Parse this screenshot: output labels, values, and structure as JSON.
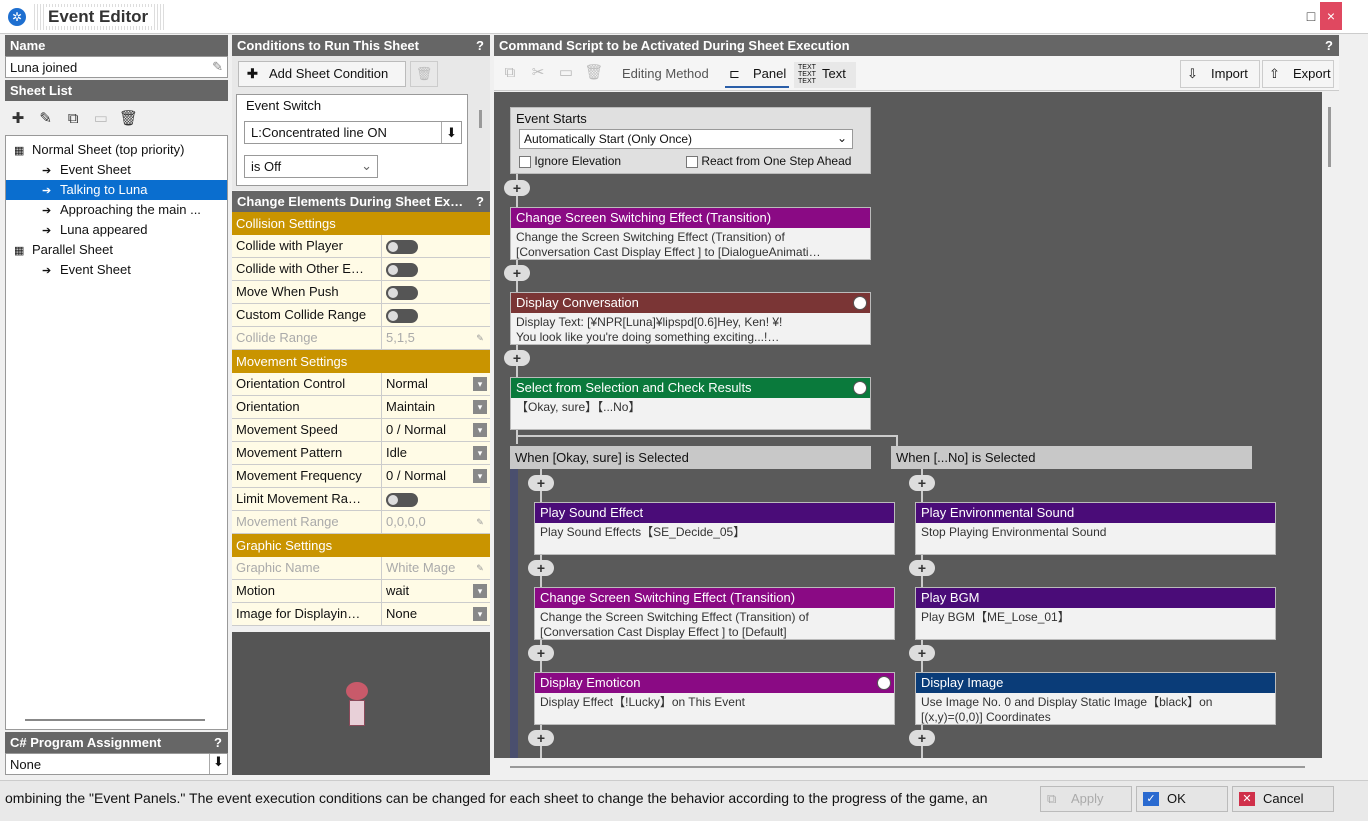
{
  "window": {
    "title": "Event Editor",
    "max_icon": "□",
    "close_icon": "×"
  },
  "left": {
    "name_header": "Name",
    "name_value": "Luna joined",
    "sheet_list_header": "Sheet List",
    "tree": [
      {
        "label": "Normal Sheet (top priority)",
        "indent": 0,
        "selected": false
      },
      {
        "label": "Event Sheet",
        "indent": 1,
        "selected": false
      },
      {
        "label": "Talking to Luna",
        "indent": 1,
        "selected": true
      },
      {
        "label": "Approaching the main ...",
        "indent": 1,
        "selected": false
      },
      {
        "label": "Luna appeared",
        "indent": 1,
        "selected": false
      },
      {
        "label": "Parallel Sheet",
        "indent": 0,
        "selected": false
      },
      {
        "label": "Event Sheet",
        "indent": 1,
        "selected": false
      }
    ],
    "csharp_header": "C# Program Assignment",
    "csharp_value": "None",
    "q": "?"
  },
  "conditions": {
    "header": "Conditions to Run This Sheet",
    "add_label": "Add Sheet Condition",
    "event_switch_label": "Event Switch",
    "switch_value": "L:Concentrated line ON",
    "state_value": "is Off"
  },
  "change": {
    "header": "Change Elements During Sheet Ex…",
    "collision": "Collision Settings",
    "rows1": [
      {
        "k": "Collide with Player",
        "type": "toggle"
      },
      {
        "k": "Collide with Other E…",
        "type": "toggle"
      },
      {
        "k": "Move When Push",
        "type": "toggle"
      },
      {
        "k": "Custom Collide Range",
        "type": "toggle"
      },
      {
        "k": "Collide Range",
        "v": "5,1,5",
        "type": "dis"
      }
    ],
    "movement": "Movement Settings",
    "rows2": [
      {
        "k": "Orientation Control",
        "v": "Normal",
        "type": "dd"
      },
      {
        "k": "Orientation",
        "v": "Maintain",
        "type": "dd"
      },
      {
        "k": "Movement Speed",
        "v": "0 / Normal",
        "type": "dd"
      },
      {
        "k": "Movement Pattern",
        "v": "Idle",
        "type": "dd"
      },
      {
        "k": "Movement Frequency",
        "v": "0 / Normal",
        "type": "dd"
      },
      {
        "k": "Limit Movement Ra…",
        "type": "toggle"
      },
      {
        "k": "Movement Range",
        "v": "0,0,0,0",
        "type": "dis"
      }
    ],
    "graphic": "Graphic Settings",
    "rows3": [
      {
        "k": "Graphic Name",
        "v": "White Mage",
        "type": "dis"
      },
      {
        "k": "Motion",
        "v": "wait",
        "type": "dd"
      },
      {
        "k": "Image for Displayin…",
        "v": "None",
        "type": "dd"
      }
    ]
  },
  "script": {
    "header": "Command Script to be Activated During Sheet Execution",
    "editing_method": "Editing Method",
    "panel": "Panel",
    "text": "Text",
    "import": "Import",
    "export": "Export",
    "event_starts": "Event Starts",
    "start_mode": "Automatically Start (Only Once)",
    "ignore_elev": "Ignore Elevation",
    "react_step": "React from One Step Ahead",
    "p1_h": "Change Screen Switching Effect (Transition)",
    "p1_b1": "Change the Screen Switching Effect (Transition) of",
    "p1_b2": "[Conversation Cast Display Effect  ] to [DialogueAnimati…",
    "p2_h": "Display Conversation",
    "p2_b1": "Display Text: [¥NPR[Luna]¥lipspd[0.6]Hey, Ken! ¥!",
    "p2_b2": "You look like you're doing something exciting...!…",
    "p3_h": "Select from Selection and Check Results",
    "p3_b1": "【Okay, sure】【...No】",
    "branch_a": "When [Okay, sure] is Selected",
    "branch_b": "When [...No] is Selected",
    "a1_h": "Play Sound Effect",
    "a1_b1": "Play Sound Effects【SE_Decide_05】",
    "a2_h": "Change Screen Switching Effect (Transition)",
    "a2_b1": "Change the Screen Switching Effect (Transition) of",
    "a2_b2": "[Conversation Cast Display Effect  ] to [Default]",
    "a3_h": "Display Emoticon",
    "a3_b1": "Display Effect【!Lucky】on This Event",
    "b1_h": "Play Environmental Sound",
    "b1_b1": "Stop Playing Environmental Sound",
    "b2_h": "Play BGM",
    "b2_b1": "Play BGM【ME_Lose_01】",
    "b3_h": "Display Image",
    "b3_b1": "Use Image No. 0 and Display Static Image【black】on",
    "b3_b2": "[(x,y)=(0,0)] Coordinates",
    "plus": "+"
  },
  "footer": {
    "hint": "ombining the \"Event Panels.\"  The event execution conditions can be changed for each sheet to change the behavior according to the progress of the game, an",
    "apply": "Apply",
    "ok": "OK",
    "cancel": "Cancel"
  },
  "colors": {
    "purple": "#8a0a84",
    "brown": "#7a3535",
    "green": "#0a7a3c",
    "violet": "#4a0c78",
    "navy": "#0a3c78"
  }
}
